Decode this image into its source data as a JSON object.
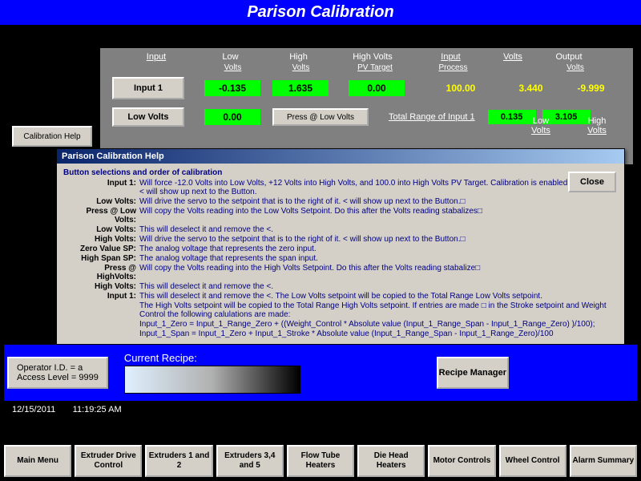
{
  "title": "Parison Calibration",
  "headers": {
    "input": "Input",
    "low": "Low",
    "high": "High",
    "high_pv": "High Volts",
    "pv_target": "PV Target",
    "input_process": "Input",
    "process": "Process",
    "volts": "Volts",
    "output": "Output",
    "out_volts": "Volts"
  },
  "row1": {
    "input1_btn": "Input 1",
    "low_volts": "-0.135",
    "high_volts": "1.635",
    "pv_target": "0.00",
    "process": "100.00",
    "volts": "3.440",
    "output_volts": "-9.999"
  },
  "lh": {
    "low": "Low",
    "high": "High",
    "volts": "Volts"
  },
  "row2": {
    "lowvolts_btn": "Low Volts",
    "low_val": "0.00",
    "press_btn": "Press @ Low Volts",
    "total_range": "Total Range of Input 1",
    "tr_low": "0.135",
    "tr_high": "3.105"
  },
  "calib_help_btn": "Calibration Help",
  "help": {
    "title": "Parison Calibration Help",
    "header": "Button selections and order of calibration",
    "rows": [
      {
        "label": "Input 1:",
        "text": "Will force -12.0 Volts into Low Volts, +12 Volts into High Volts, and 100.0 into High Volts PV Target.  Calibration is enabled at this point.   < will show up next to the Button."
      },
      {
        "label": "Low Volts:",
        "text": "Will drive the servo to the setpoint that is to the right of it. <  will show up next to the Button.□"
      },
      {
        "label": "Press @ Low Volts:",
        "text": "Will copy the Volts reading into the Low Volts Setpoint.  Do this after the Volts reading stabalizes□"
      },
      {
        "label": "Low Volts:",
        "text": "This will deselect it and remove the <."
      },
      {
        "label": "High Volts:",
        "text": "Will drive the servo to the setpoint that is to the right of it. <  will show up next to the Button.□"
      },
      {
        "label": "Zero Value SP:",
        "text": "The analog voltage that represents the zero input."
      },
      {
        "label": "High Span SP:",
        "text": "The analog voltage that represents the span input."
      },
      {
        "label": "Press @ HighVolts:",
        "text": "Will copy the Volts reading into the High Volts Setpoint.  Do this after the Volts reading stabalize□"
      },
      {
        "label": "High Volts:",
        "text": "This will deselect it and remove the <."
      },
      {
        "label": "Input 1:",
        "text": "This will deselect it and remove the <.   The Low Volts setpoint will be copied to the Total Range Low Volts setpoint."
      }
    ],
    "tail1": "The High Volts setpoint will be copied to the Total Range High Volts setpoint.  If entries are made □                            in the Stroke setpoint and Weight Control the following calulations are made:",
    "tail2": "Input_1_Zero  = Input_1_Range_Zero + ((Weight_Control * Absolute value (Input_1_Range_Span - Input_1_Range_Zero) )/100);",
    "tail3": "Input_1_Span = Input_1_Zero + Input_1_Stroke * Absolute value (Input_1_Range_Span - Input_1_Range_Zero)/100",
    "close": "Close"
  },
  "status": {
    "operator_lbl": "Operator I.D. =  a",
    "access_lbl": "Access Level =  9999",
    "date": "12/15/2011",
    "time": "11:19:25 AM",
    "recipe_lbl": "Current Recipe:",
    "recipe_mgr": "Recipe Manager"
  },
  "nav": [
    "Main Menu",
    "Extruder Drive Control",
    "Extruders 1 and 2",
    "Extruders 3,4 and 5",
    "Flow Tube Heaters",
    "Die Head Heaters",
    "Motor Controls",
    "Wheel Control",
    "Alarm Summary"
  ]
}
